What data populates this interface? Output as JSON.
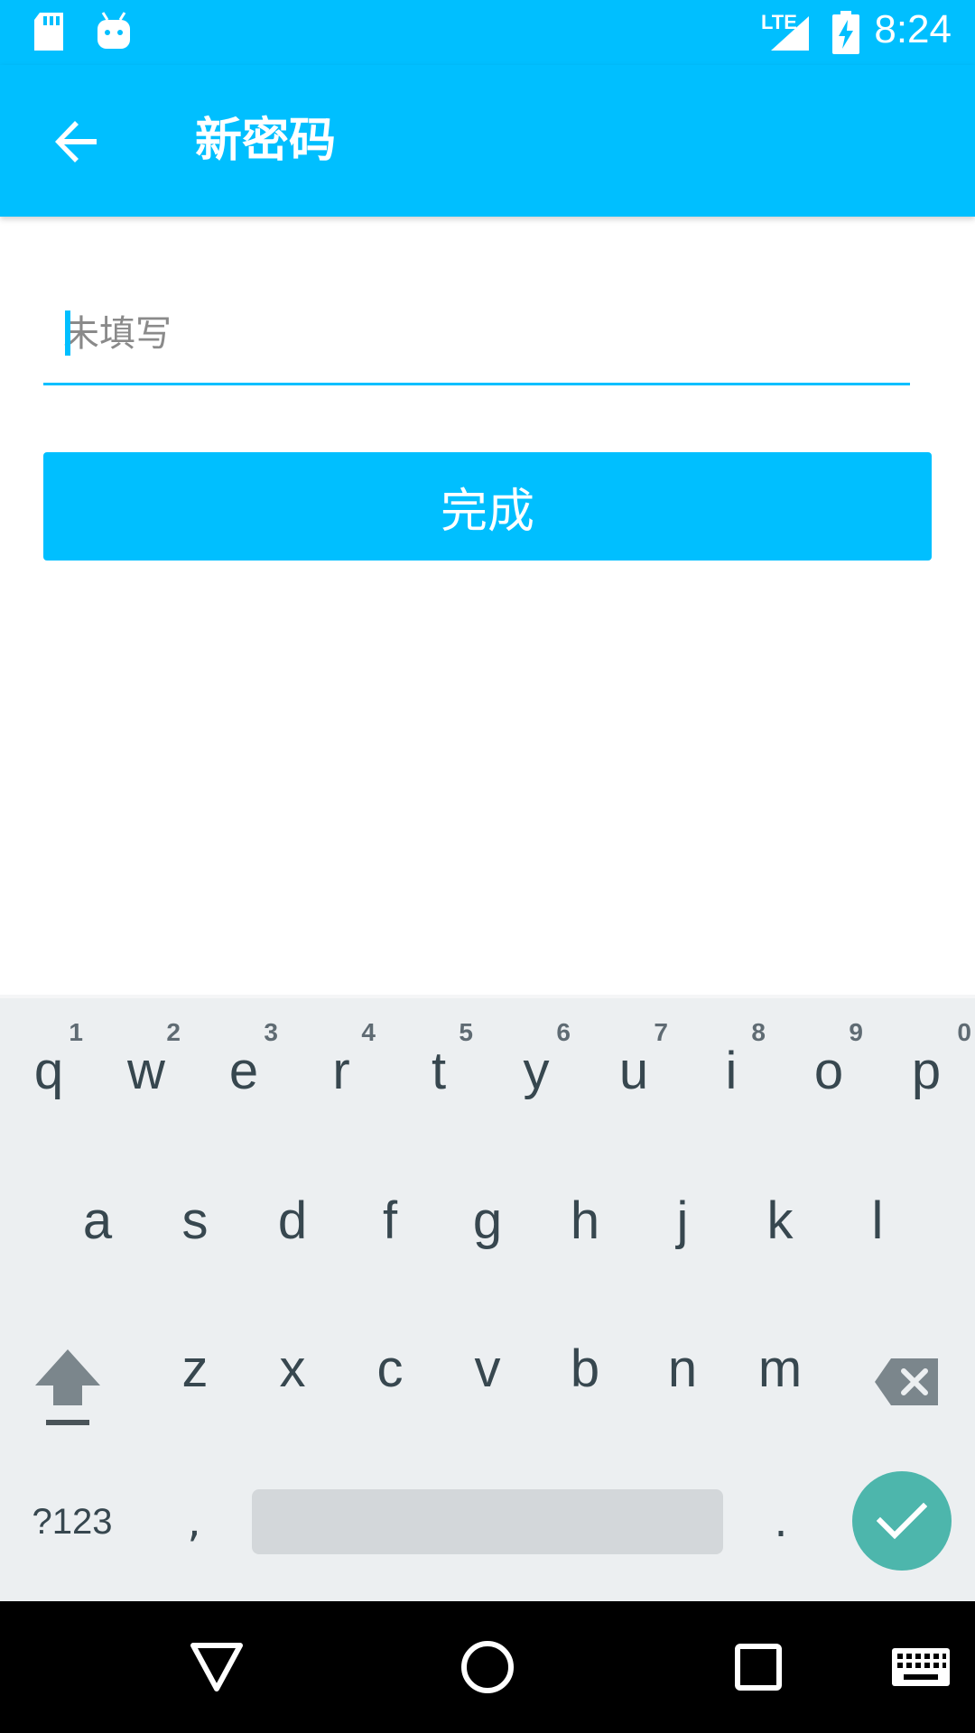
{
  "status_bar": {
    "time": "8:24",
    "network": "LTE",
    "icons": [
      "sd-card-icon",
      "android-debug-icon",
      "signal-icon",
      "battery-charging-icon"
    ]
  },
  "app_bar": {
    "title": "新密码",
    "back_icon": "arrow-back-icon"
  },
  "form": {
    "password_placeholder": "未填写",
    "password_value": "",
    "submit_label": "完成"
  },
  "keyboard": {
    "row1": [
      {
        "key": "q",
        "hint": "1"
      },
      {
        "key": "w",
        "hint": "2"
      },
      {
        "key": "e",
        "hint": "3"
      },
      {
        "key": "r",
        "hint": "4"
      },
      {
        "key": "t",
        "hint": "5"
      },
      {
        "key": "y",
        "hint": "6"
      },
      {
        "key": "u",
        "hint": "7"
      },
      {
        "key": "i",
        "hint": "8"
      },
      {
        "key": "o",
        "hint": "9"
      },
      {
        "key": "p",
        "hint": "0"
      }
    ],
    "row2": [
      "a",
      "s",
      "d",
      "f",
      "g",
      "h",
      "j",
      "k",
      "l"
    ],
    "row3": [
      "z",
      "x",
      "c",
      "v",
      "b",
      "n",
      "m"
    ],
    "symbols_label": "?123",
    "comma": ",",
    "period": ".",
    "shift_icon": "shift-icon",
    "backspace_icon": "backspace-icon",
    "enter_icon": "check-icon"
  },
  "nav_bar": {
    "icons": [
      "back-triangle-icon",
      "home-circle-icon",
      "recents-square-icon",
      "keyboard-icon"
    ]
  },
  "colors": {
    "primary": "#00BFFF",
    "keyboard_bg": "#ECEFF1",
    "key_text": "#37474F",
    "enter": "#4DB6AC"
  }
}
